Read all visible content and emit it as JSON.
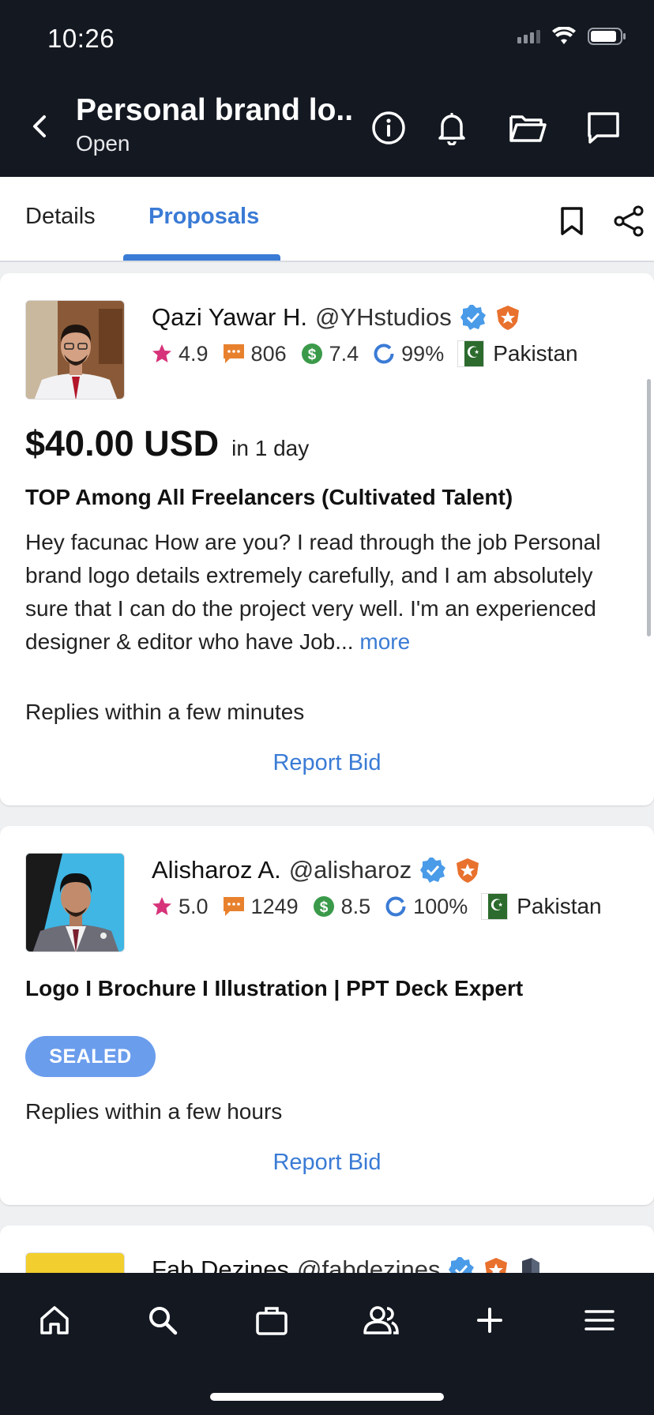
{
  "status_bar": {
    "time": "10:26"
  },
  "header": {
    "title": "Personal brand lo...",
    "subtitle": "Open",
    "icons": [
      "back-arrow-icon",
      "info-icon",
      "bell-icon",
      "folder-icon",
      "chat-icon"
    ]
  },
  "tabs": {
    "details": "Details",
    "proposals": "Proposals",
    "active": "Proposals",
    "accent_color": "#3a7bd5"
  },
  "proposals": [
    {
      "name": "Qazi Yawar H.",
      "handle": "@YHstudios",
      "rating": "4.9",
      "reviews": "806",
      "earnings": "7.4",
      "completion": "99%",
      "country": "Pakistan",
      "price": "$40.00 USD",
      "delivery": "in 1 day",
      "headline": "TOP Among All Freelancers (Cultivated Talent)",
      "description": "Hey facunac How are you? I read through the job Personal brand logo details extremely carefully, and I am absolutely sure that I can do the project very well.  I'm an experienced designer & editor who have Job...",
      "more_label": "more",
      "replies": "Replies within a few minutes",
      "report_label": "Report Bid"
    },
    {
      "name": "Alisharoz A.",
      "handle": "@alisharoz",
      "rating": "5.0",
      "reviews": "1249",
      "earnings": "8.5",
      "completion": "100%",
      "country": "Pakistan",
      "headline": "Logo I Brochure I Illustration | PPT Deck Expert",
      "sealed_label": "SEALED",
      "replies": "Replies within a few hours",
      "report_label": "Report Bid"
    },
    {
      "name": "Fab Dezines",
      "handle": "@fabdezines"
    }
  ],
  "bottom_nav": [
    "home-icon",
    "search-icon",
    "briefcase-icon",
    "users-icon",
    "plus-icon",
    "menu-icon"
  ]
}
